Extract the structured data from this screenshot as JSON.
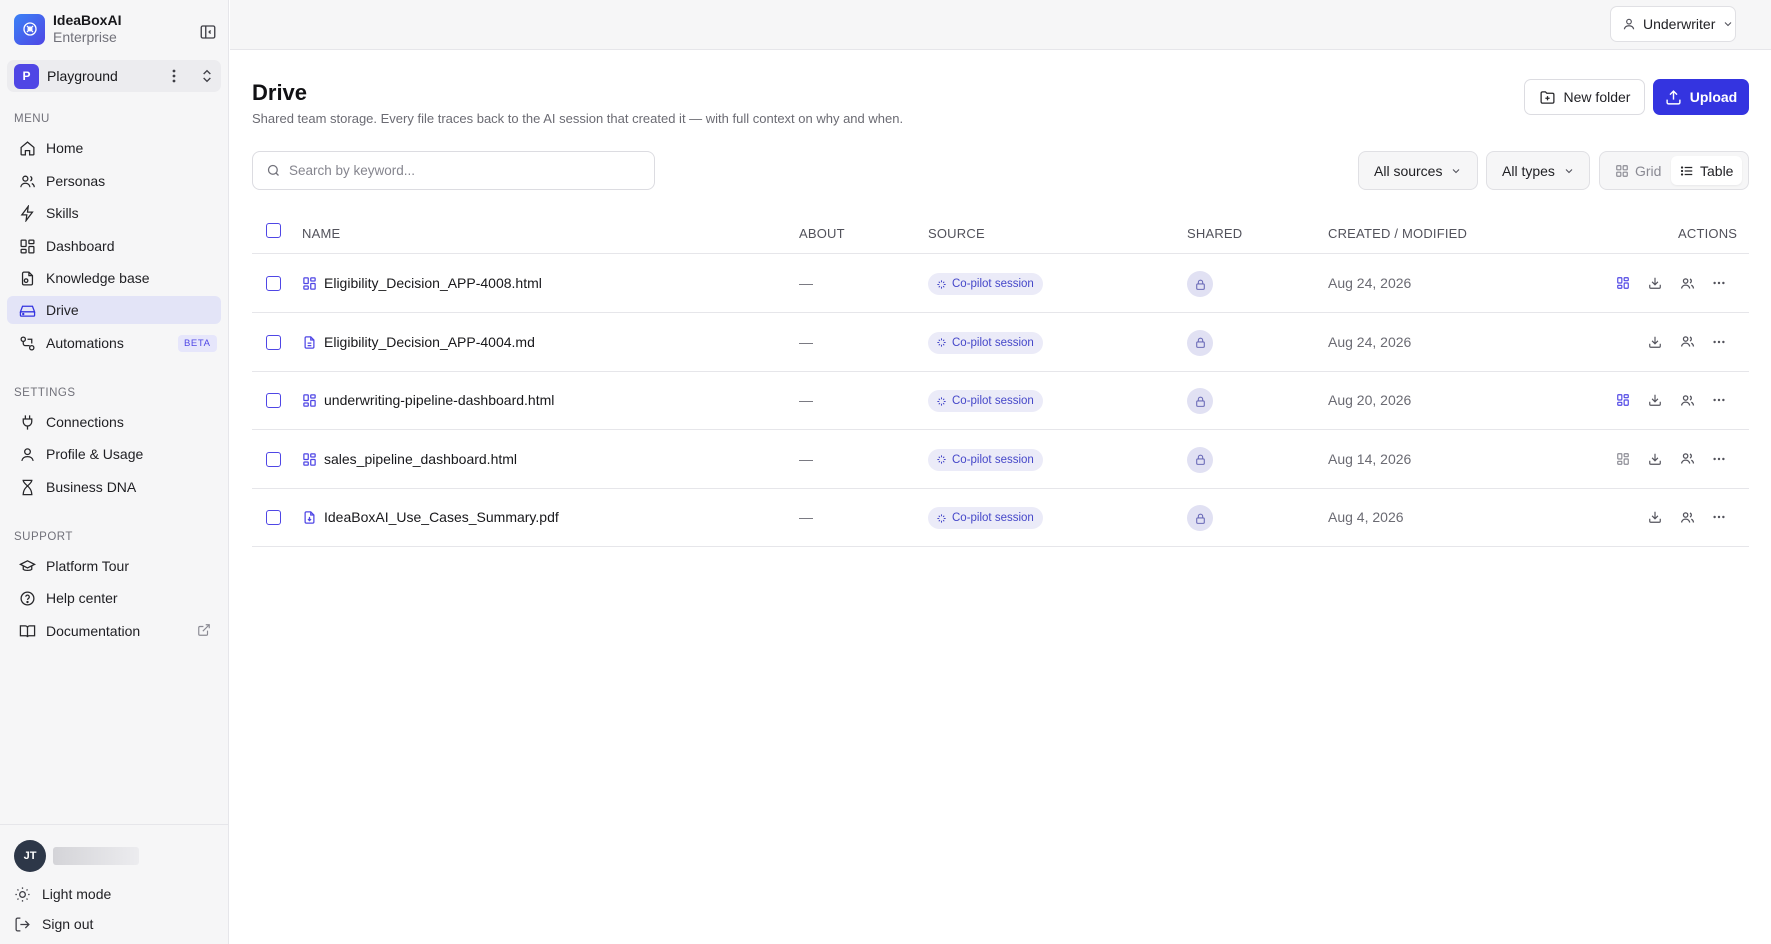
{
  "app": {
    "name": "IdeaBoxAI",
    "plan": "Enterprise"
  },
  "workspace": {
    "initial": "P",
    "name": "Playground"
  },
  "sidebar": {
    "menu_label": "MENU",
    "menu": [
      {
        "label": "Home",
        "icon": "home-icon"
      },
      {
        "label": "Personas",
        "icon": "users-icon"
      },
      {
        "label": "Skills",
        "icon": "zap-icon"
      },
      {
        "label": "Dashboard",
        "icon": "dashboard-icon"
      },
      {
        "label": "Knowledge base",
        "icon": "book-file-icon"
      },
      {
        "label": "Drive",
        "icon": "drive-icon",
        "active": true
      },
      {
        "label": "Automations",
        "icon": "workflow-icon",
        "badge": "BETA"
      }
    ],
    "settings_label": "SETTINGS",
    "settings": [
      {
        "label": "Connections",
        "icon": "plug-icon"
      },
      {
        "label": "Profile & Usage",
        "icon": "user-icon"
      },
      {
        "label": "Business DNA",
        "icon": "dna-icon"
      }
    ],
    "support_label": "SUPPORT",
    "support": [
      {
        "label": "Platform Tour",
        "icon": "graduation-cap-icon"
      },
      {
        "label": "Help center",
        "icon": "help-circle-icon"
      },
      {
        "label": "Documentation",
        "icon": "book-open-icon"
      }
    ],
    "user": {
      "initials": "JT"
    },
    "light_mode": "Light mode",
    "sign_out": "Sign out"
  },
  "topbar": {
    "role": "Underwriter"
  },
  "page": {
    "title": "Drive",
    "subtitle": "Shared team storage. Every file traces back to the AI session that created it — with full context on why and when.",
    "new_folder": "New folder",
    "upload": "Upload"
  },
  "search": {
    "placeholder": "Search by keyword..."
  },
  "filters": {
    "sources": "All sources",
    "types": "All types"
  },
  "view": {
    "grid": "Grid",
    "table": "Table",
    "selected": "Table"
  },
  "table": {
    "headers": {
      "name": "NAME",
      "about": "ABOUT",
      "source": "SOURCE",
      "shared": "SHARED",
      "created": "CREATED / MODIFIED",
      "actions": "ACTIONS"
    },
    "rows": [
      {
        "name": "Eligibility_Decision_APP-4008.html",
        "type": "html",
        "about": "—",
        "source": "Co-pilot session",
        "date": "Aug 24, 2026",
        "dashboard_action": "active"
      },
      {
        "name": "Eligibility_Decision_APP-4004.md",
        "type": "md",
        "about": "—",
        "source": "Co-pilot session",
        "date": "Aug 24, 2026",
        "dashboard_action": "none"
      },
      {
        "name": "underwriting-pipeline-dashboard.html",
        "type": "html",
        "about": "—",
        "source": "Co-pilot session",
        "date": "Aug 20, 2026",
        "dashboard_action": "active"
      },
      {
        "name": "sales_pipeline_dashboard.html",
        "type": "html",
        "about": "—",
        "source": "Co-pilot session",
        "date": "Aug 14, 2026",
        "dashboard_action": "muted"
      },
      {
        "name": "IdeaBoxAI_Use_Cases_Summary.pdf",
        "type": "pdf",
        "about": "—",
        "source": "Co-pilot session",
        "date": "Aug 4, 2026",
        "dashboard_action": "none"
      }
    ]
  },
  "colors": {
    "accent": "#3434e0",
    "accent_soft": "#e3e4f7",
    "pill_text": "#4547c9",
    "muted_text": "#71717a"
  }
}
